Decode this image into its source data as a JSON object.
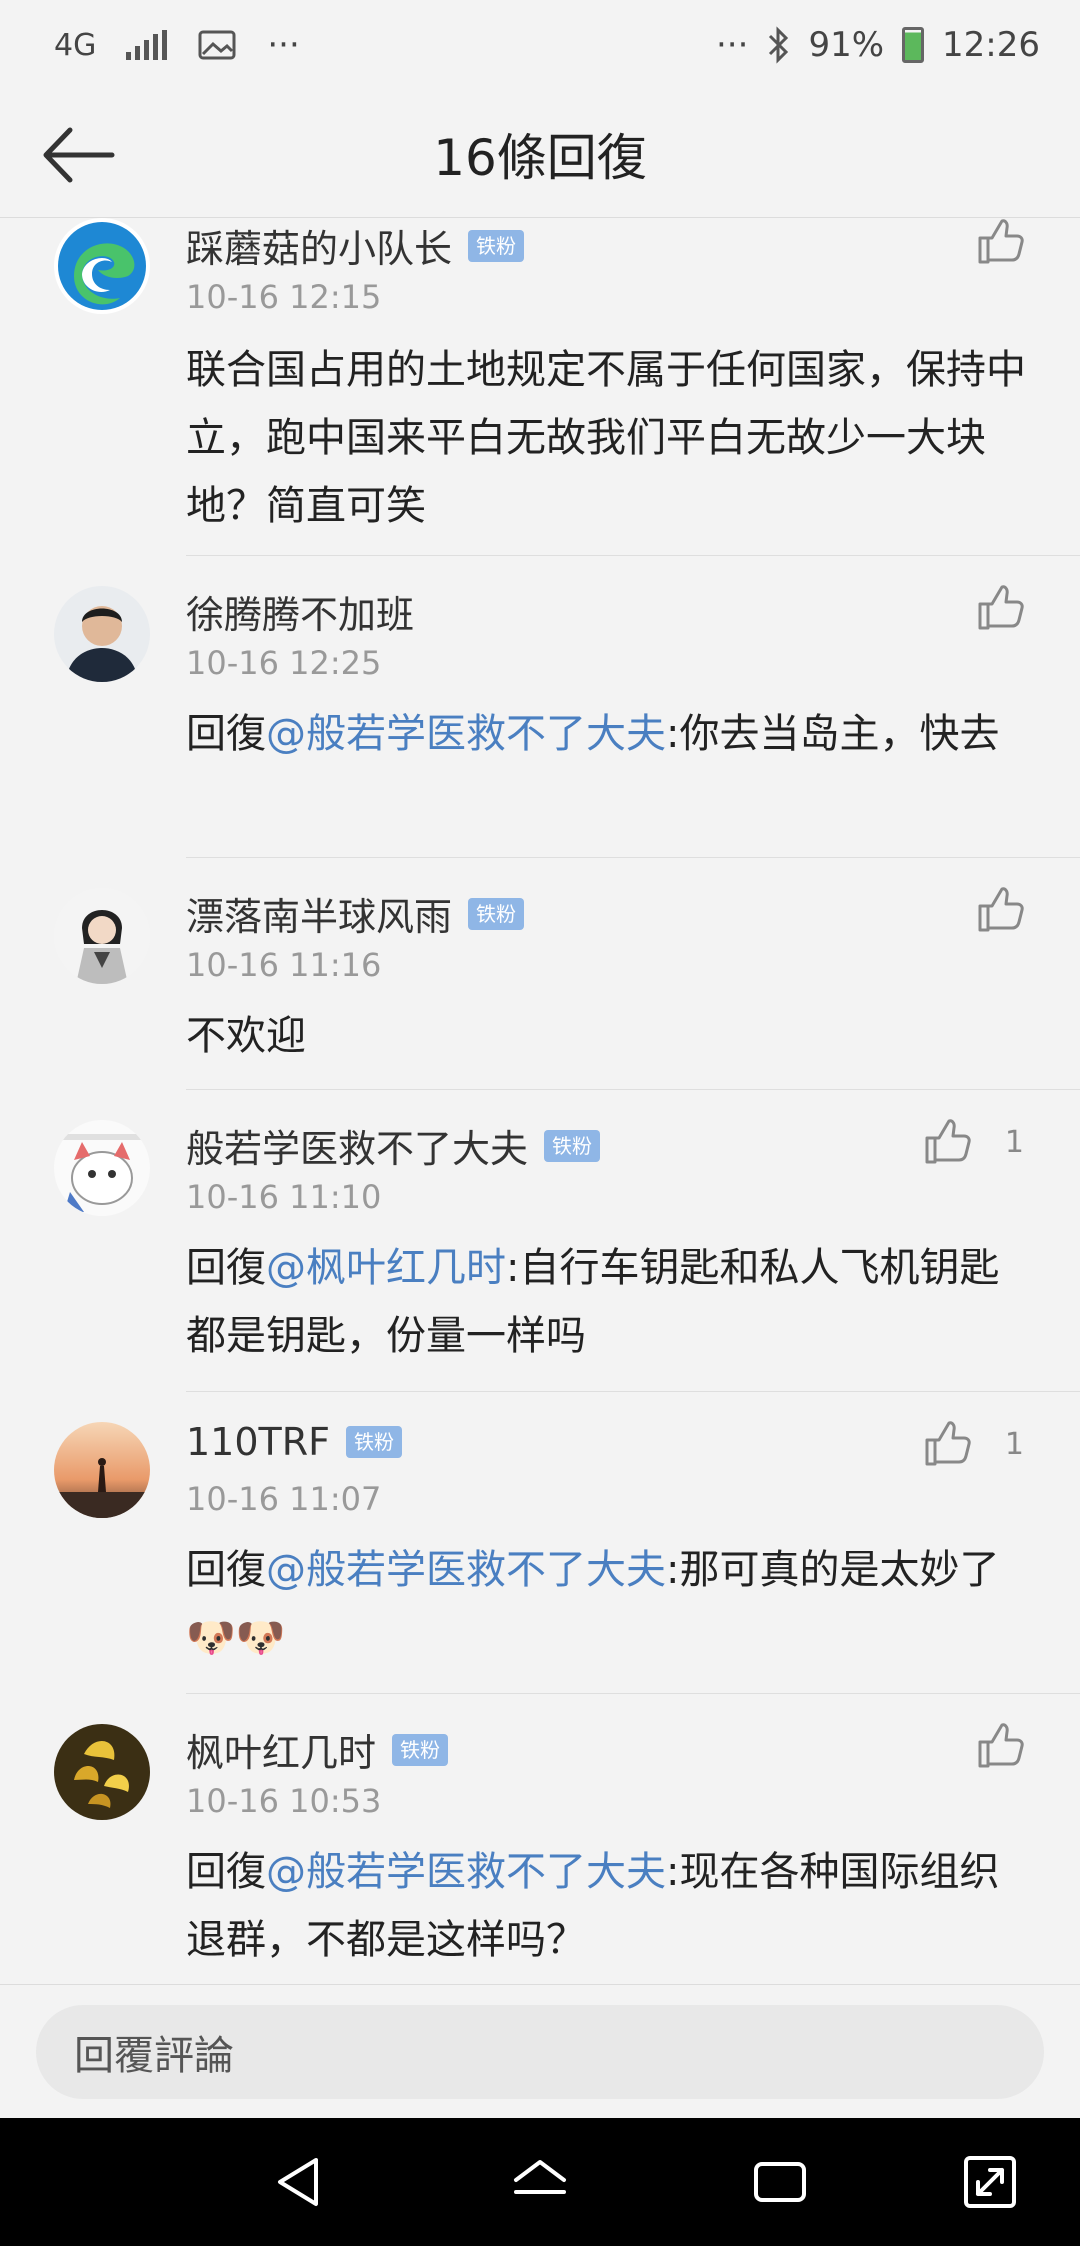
{
  "status_bar": {
    "network": "4G",
    "dots_left": "···",
    "dots_right": "···",
    "battery": "91%",
    "time": "12:26"
  },
  "header": {
    "title": "16條回復"
  },
  "comments": [
    {
      "name": "踩蘑菇的小队长",
      "badge": "铁粉",
      "time": "10-16 12:15",
      "text": "联合国占用的土地规定不属于任何国家，保持中立，跑中国来平白无故我们平白无故少一大块地？简直可笑",
      "likes": ""
    },
    {
      "name": "徐腾腾不加班",
      "badge": "",
      "time": "10-16 12:25",
      "prefix": "回復",
      "mention": "@般若学医救不了大夫",
      "text": ":你去当岛主，快去",
      "likes": ""
    },
    {
      "name": "漂落南半球风雨",
      "badge": "铁粉",
      "time": "10-16 11:16",
      "text": "不欢迎",
      "likes": ""
    },
    {
      "name": "般若学医救不了大夫",
      "badge": "铁粉",
      "time": "10-16 11:10",
      "prefix": "回復",
      "mention": "@枫叶红几时",
      "text": ":自行车钥匙和私人飞机钥匙都是钥匙，份量一样吗",
      "likes": "1"
    },
    {
      "name": "110TRF",
      "badge": "铁粉",
      "time": "10-16 11:07",
      "prefix": "回復",
      "mention": "@般若学医救不了大夫",
      "text": ":那可真的是太妙了",
      "emoji": "🐶🐶",
      "likes": "1"
    },
    {
      "name": "枫叶红几时",
      "badge": "铁粉",
      "time": "10-16 10:53",
      "prefix": "回復",
      "mention": "@般若学医救不了大夫",
      "text": ":现在各种国际组织退群，不都是这样吗？",
      "likes": ""
    }
  ],
  "reply_bar": {
    "placeholder": "回覆評論"
  },
  "colors": {
    "mention": "#4a7fc1",
    "badge": "#8fb6e6"
  }
}
